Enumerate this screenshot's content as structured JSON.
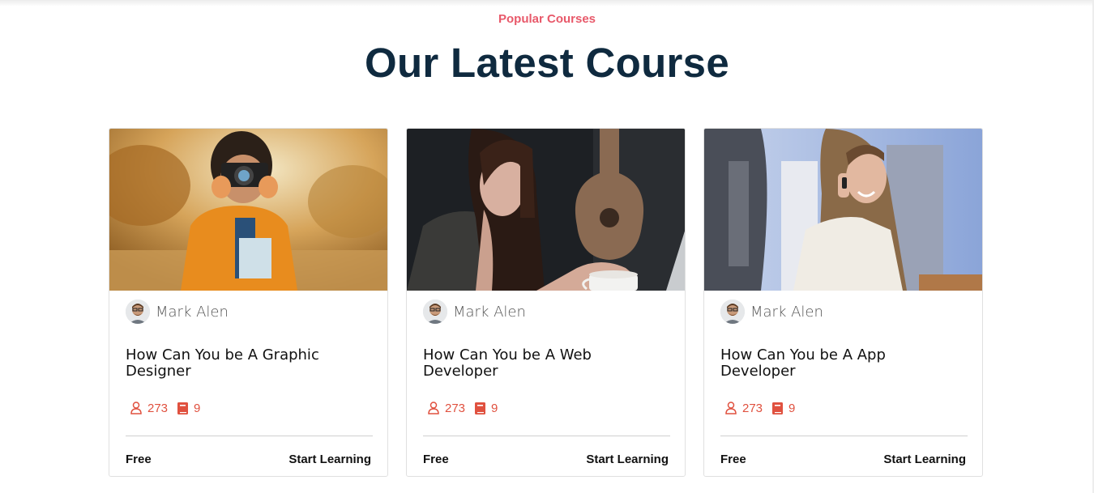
{
  "section": {
    "eyebrow": "Popular Courses",
    "title": "Our Latest Course"
  },
  "courses": [
    {
      "image": "photographer-child-with-camera",
      "author": "Mark Alen",
      "title": "How Can You be A Graphic Designer",
      "students": "273",
      "lessons": "9",
      "price": "Free",
      "cta": "Start Learning"
    },
    {
      "image": "woman-with-coffee-and-guitar",
      "author": "Mark Alen",
      "title": "How Can You be A Web Developer",
      "students": "273",
      "lessons": "9",
      "price": "Free",
      "cta": "Start Learning"
    },
    {
      "image": "woman-on-phone-outdoors",
      "author": "Mark Alen",
      "title": "How Can You be A App Developer",
      "students": "273",
      "lessons": "9",
      "price": "Free",
      "cta": "Start Learning"
    }
  ],
  "colors": {
    "accent": "#e8596a",
    "heading": "#0f2a3f",
    "stat": "#e0513f"
  },
  "icons": {
    "students": "user-icon",
    "lessons": "book-icon"
  }
}
